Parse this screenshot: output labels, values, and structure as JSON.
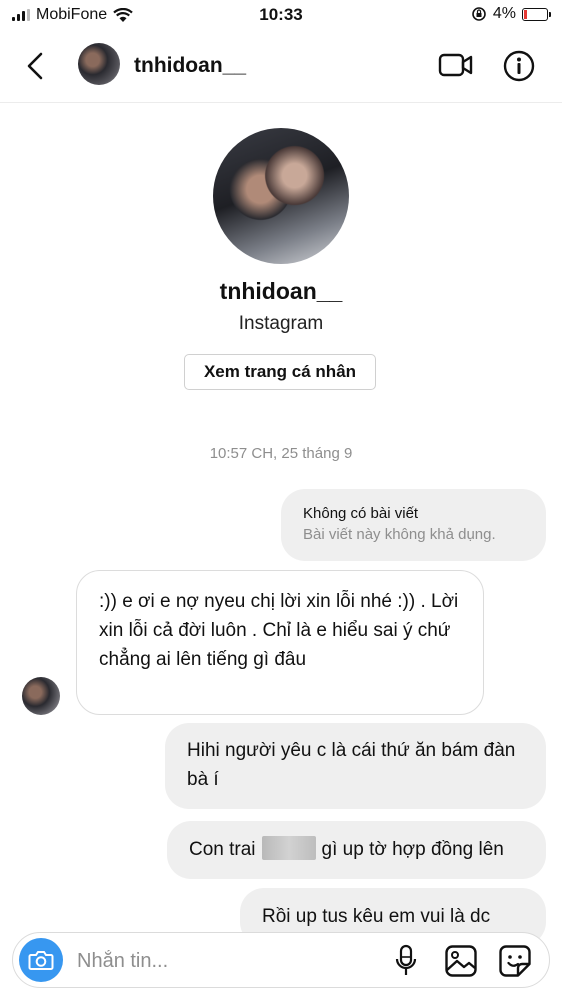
{
  "status_bar": {
    "carrier": "MobiFone",
    "time": "10:33",
    "battery": "4%"
  },
  "header": {
    "username": "tnhidoan__"
  },
  "profile": {
    "username": "tnhidoan__",
    "subtitle": "Instagram",
    "view_profile_label": "Xem trang cá nhân"
  },
  "conversation": {
    "timestamp": "10:57 CH, 25 tháng 9",
    "shared_post": {
      "title": "Không có bài viết",
      "subtitle": "Bài viết này không khả dụng."
    },
    "incoming_message": ":)) e ơi e nợ nyeu chị lời xin lỗi nhé :)) . Lời xin lỗi cả đời luôn . Chỉ là e hiểu sai ý chứ chẳng ai lên tiếng gì đâu",
    "outgoing_1": "Hihi người yêu c là cái thứ ăn bám đàn bà í",
    "outgoing_2_before": "Con trai",
    "outgoing_2_after": "gì up tờ hợp đồng lên",
    "outgoing_3": "Rồi up tus kêu em vui là dc"
  },
  "composer": {
    "placeholder": "Nhắn tin..."
  },
  "colors": {
    "accent": "#3797f0",
    "bubble": "#efefef",
    "battery_low": "#e53935"
  }
}
